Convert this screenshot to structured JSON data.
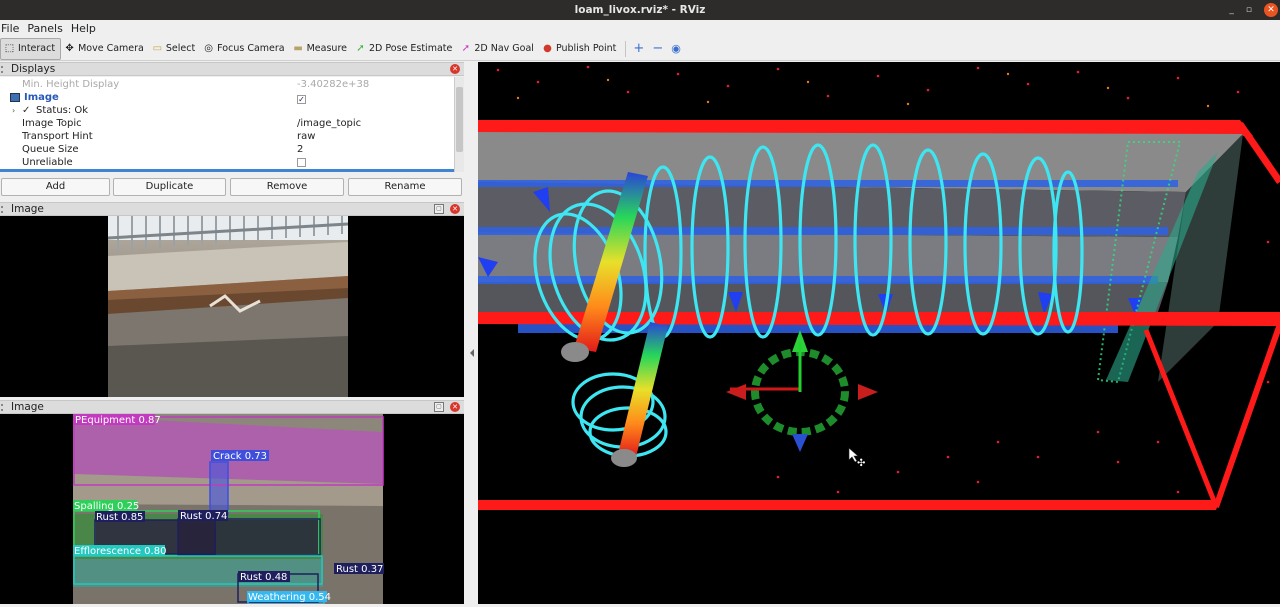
{
  "window": {
    "title": "loam_livox.rviz* - RViz",
    "minimize": "_",
    "restore": "▫",
    "close": "✕"
  },
  "menu": [
    "File",
    "Panels",
    "Help"
  ],
  "toolbar": {
    "items": [
      {
        "label": "Interact",
        "icon": "interact-icon",
        "glyph": "⬚"
      },
      {
        "label": "Move Camera",
        "icon": "move-camera-icon",
        "glyph": "✥"
      },
      {
        "label": "Select",
        "icon": "select-icon",
        "glyph": "▭"
      },
      {
        "label": "Focus Camera",
        "icon": "focus-camera-icon",
        "glyph": "◎"
      },
      {
        "label": "Measure",
        "icon": "measure-icon",
        "glyph": "▬"
      },
      {
        "label": "2D Pose Estimate",
        "icon": "pose-estimate-icon",
        "glyph": "➚"
      },
      {
        "label": "2D Nav Goal",
        "icon": "nav-goal-icon",
        "glyph": "➚"
      },
      {
        "label": "Publish Point",
        "icon": "publish-point-icon",
        "glyph": "●"
      }
    ],
    "extra": [
      "+",
      "−",
      "◉"
    ]
  },
  "displays": {
    "title": "Displays",
    "rows": [
      {
        "key": "Min. Height Display",
        "value": "-3.40282e+38"
      },
      {
        "key": "Image",
        "value": ""
      },
      {
        "key": "Status: Ok",
        "value": ""
      },
      {
        "key": "Image Topic",
        "value": "/image_topic"
      },
      {
        "key": "Transport Hint",
        "value": "raw"
      },
      {
        "key": "Queue Size",
        "value": "2"
      },
      {
        "key": "Unreliable",
        "value": ""
      }
    ],
    "buttons": [
      "Add",
      "Duplicate",
      "Remove",
      "Rename"
    ]
  },
  "image_panel_1": {
    "title": "Image"
  },
  "image_panel_2": {
    "title": "Image",
    "detections": [
      {
        "label": "PEquipment 0.87",
        "color": "#c23bbf"
      },
      {
        "label": "Crack 0.73",
        "color": "#3f4fdc"
      },
      {
        "label": "Spalling 0.25",
        "color": "#2fd05a"
      },
      {
        "label": "Rust 0.85",
        "color": "#1e1f5c"
      },
      {
        "label": "Rust 0.74",
        "color": "#1e1f5c"
      },
      {
        "label": "Efflorescence 0.80",
        "color": "#23c9c0"
      },
      {
        "label": "Rust 0.48",
        "color": "#1e1f5c"
      },
      {
        "label": "Rust 0.37",
        "color": "#1e1f5c"
      },
      {
        "label": "Weathering 0.54",
        "color": "#35b7f0"
      }
    ]
  },
  "colors": {
    "bbox_red": "#ff1a1a",
    "trajectory": "#3ee6f2",
    "beam": "#8a8a8a"
  }
}
